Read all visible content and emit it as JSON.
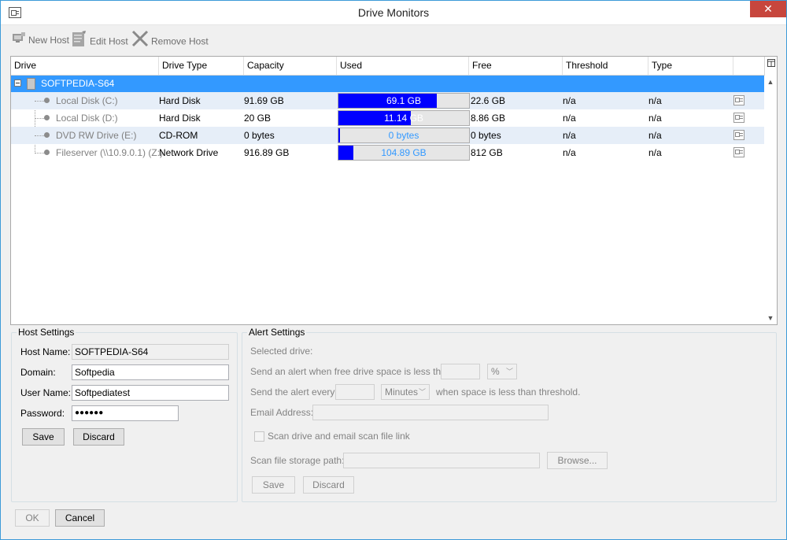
{
  "window": {
    "title": "Drive Monitors",
    "close_glyph": "✕"
  },
  "toolbar": {
    "new_host": "New Host",
    "edit_host": "Edit Host",
    "remove_host": "Remove Host"
  },
  "grid": {
    "columns": [
      "Drive",
      "Drive Type",
      "Capacity",
      "Used",
      "Free",
      "Threshold",
      "Type"
    ],
    "host": "SOFTPEDIA-S64",
    "rows": [
      {
        "drive": "Local Disk (C:)",
        "drive_type": "Hard Disk",
        "capacity": "91.69 GB",
        "used": "69.1 GB",
        "used_fraction": 0.754,
        "free": "22.6 GB",
        "threshold": "n/a",
        "type": "n/a"
      },
      {
        "drive": "Local Disk (D:)",
        "drive_type": "Hard Disk",
        "capacity": "20 GB",
        "used": "11.14 GB",
        "used_fraction": 0.557,
        "free": "8.86 GB",
        "threshold": "n/a",
        "type": "n/a"
      },
      {
        "drive": "DVD RW Drive (E:)",
        "drive_type": "CD-ROM",
        "capacity": "0 bytes",
        "used": "0 bytes",
        "used_fraction": 0.01,
        "free": "0 bytes",
        "threshold": "n/a",
        "type": "n/a"
      },
      {
        "drive": "Fileserver (\\\\10.9.0.1) (Z:)",
        "drive_type": "Network Drive",
        "capacity": "916.89 GB",
        "used": "104.89 GB",
        "used_fraction": 0.114,
        "free": "812 GB",
        "threshold": "n/a",
        "type": "n/a"
      }
    ]
  },
  "host_settings": {
    "title": "Host Settings",
    "host_name_label": "Host Name:",
    "host_name_value": "SOFTPEDIA-S64",
    "domain_label": "Domain:",
    "domain_value": "Softpedia",
    "user_label": "User Name:",
    "user_value": "Softpediatest",
    "password_label": "Password:",
    "password_value": "●●●●●●",
    "save": "Save",
    "discard": "Discard"
  },
  "alert_settings": {
    "title": "Alert Settings",
    "selected_drive": "Selected drive:",
    "free_space_label": "Send an alert when free drive space is less than",
    "unit_value": "%",
    "every_label": "Send the alert every",
    "interval_unit": "Minutes",
    "threshold_suffix": "when space is less than threshold.",
    "email_label": "Email Address:",
    "scan_checkbox": "Scan drive and email scan file link",
    "storage_label": "Scan file storage path:",
    "browse": "Browse...",
    "save": "Save",
    "discard": "Discard"
  },
  "footer": {
    "ok": "OK",
    "cancel": "Cancel"
  },
  "colors": {
    "selection": "#3399ff",
    "used_fill": "#0000ff",
    "used_text": "#3399ff",
    "close": "#c7463d"
  }
}
